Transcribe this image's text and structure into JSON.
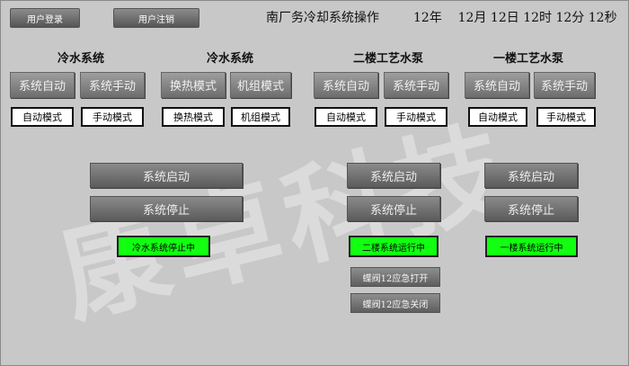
{
  "header": {
    "login_label": "用户登录",
    "logout_label": "用户注销",
    "title": "南厂务冷却系统操作",
    "clock": {
      "year": "12年",
      "month": "12月",
      "day": "12日",
      "hour": "12时",
      "minute": "12分",
      "second": "12秒"
    }
  },
  "watermark": "康卓科技",
  "sections": [
    {
      "title": "冷水系统",
      "btn1": "系统自动",
      "btn2": "系统手动",
      "mode1": "自动模式",
      "mode2": "手动模式"
    },
    {
      "title": "冷水系统",
      "btn1": "换热模式",
      "btn2": "机组模式",
      "mode1": "换热模式",
      "mode2": "机组模式"
    },
    {
      "title": "二楼工艺水泵",
      "btn1": "系统自动",
      "btn2": "系统手动",
      "mode1": "自动模式",
      "mode2": "手动模式"
    },
    {
      "title": "一楼工艺水泵",
      "btn1": "系统自动",
      "btn2": "系统手动",
      "mode1": "自动模式",
      "mode2": "手动模式"
    }
  ],
  "controls": {
    "left": {
      "start": "系统启动",
      "stop": "系统停止",
      "status": "冷水系统停止中"
    },
    "mid": {
      "start": "系统启动",
      "stop": "系统停止",
      "status": "二楼系统运行中",
      "valve_open": "蝶阀12应急打开",
      "valve_close": "蝶阀12应急关闭"
    },
    "right": {
      "start": "系统启动",
      "stop": "系统停止",
      "status": "一楼系统运行中"
    }
  },
  "colors": {
    "status_green": "#12ff12",
    "background": "#c8c8c8"
  }
}
